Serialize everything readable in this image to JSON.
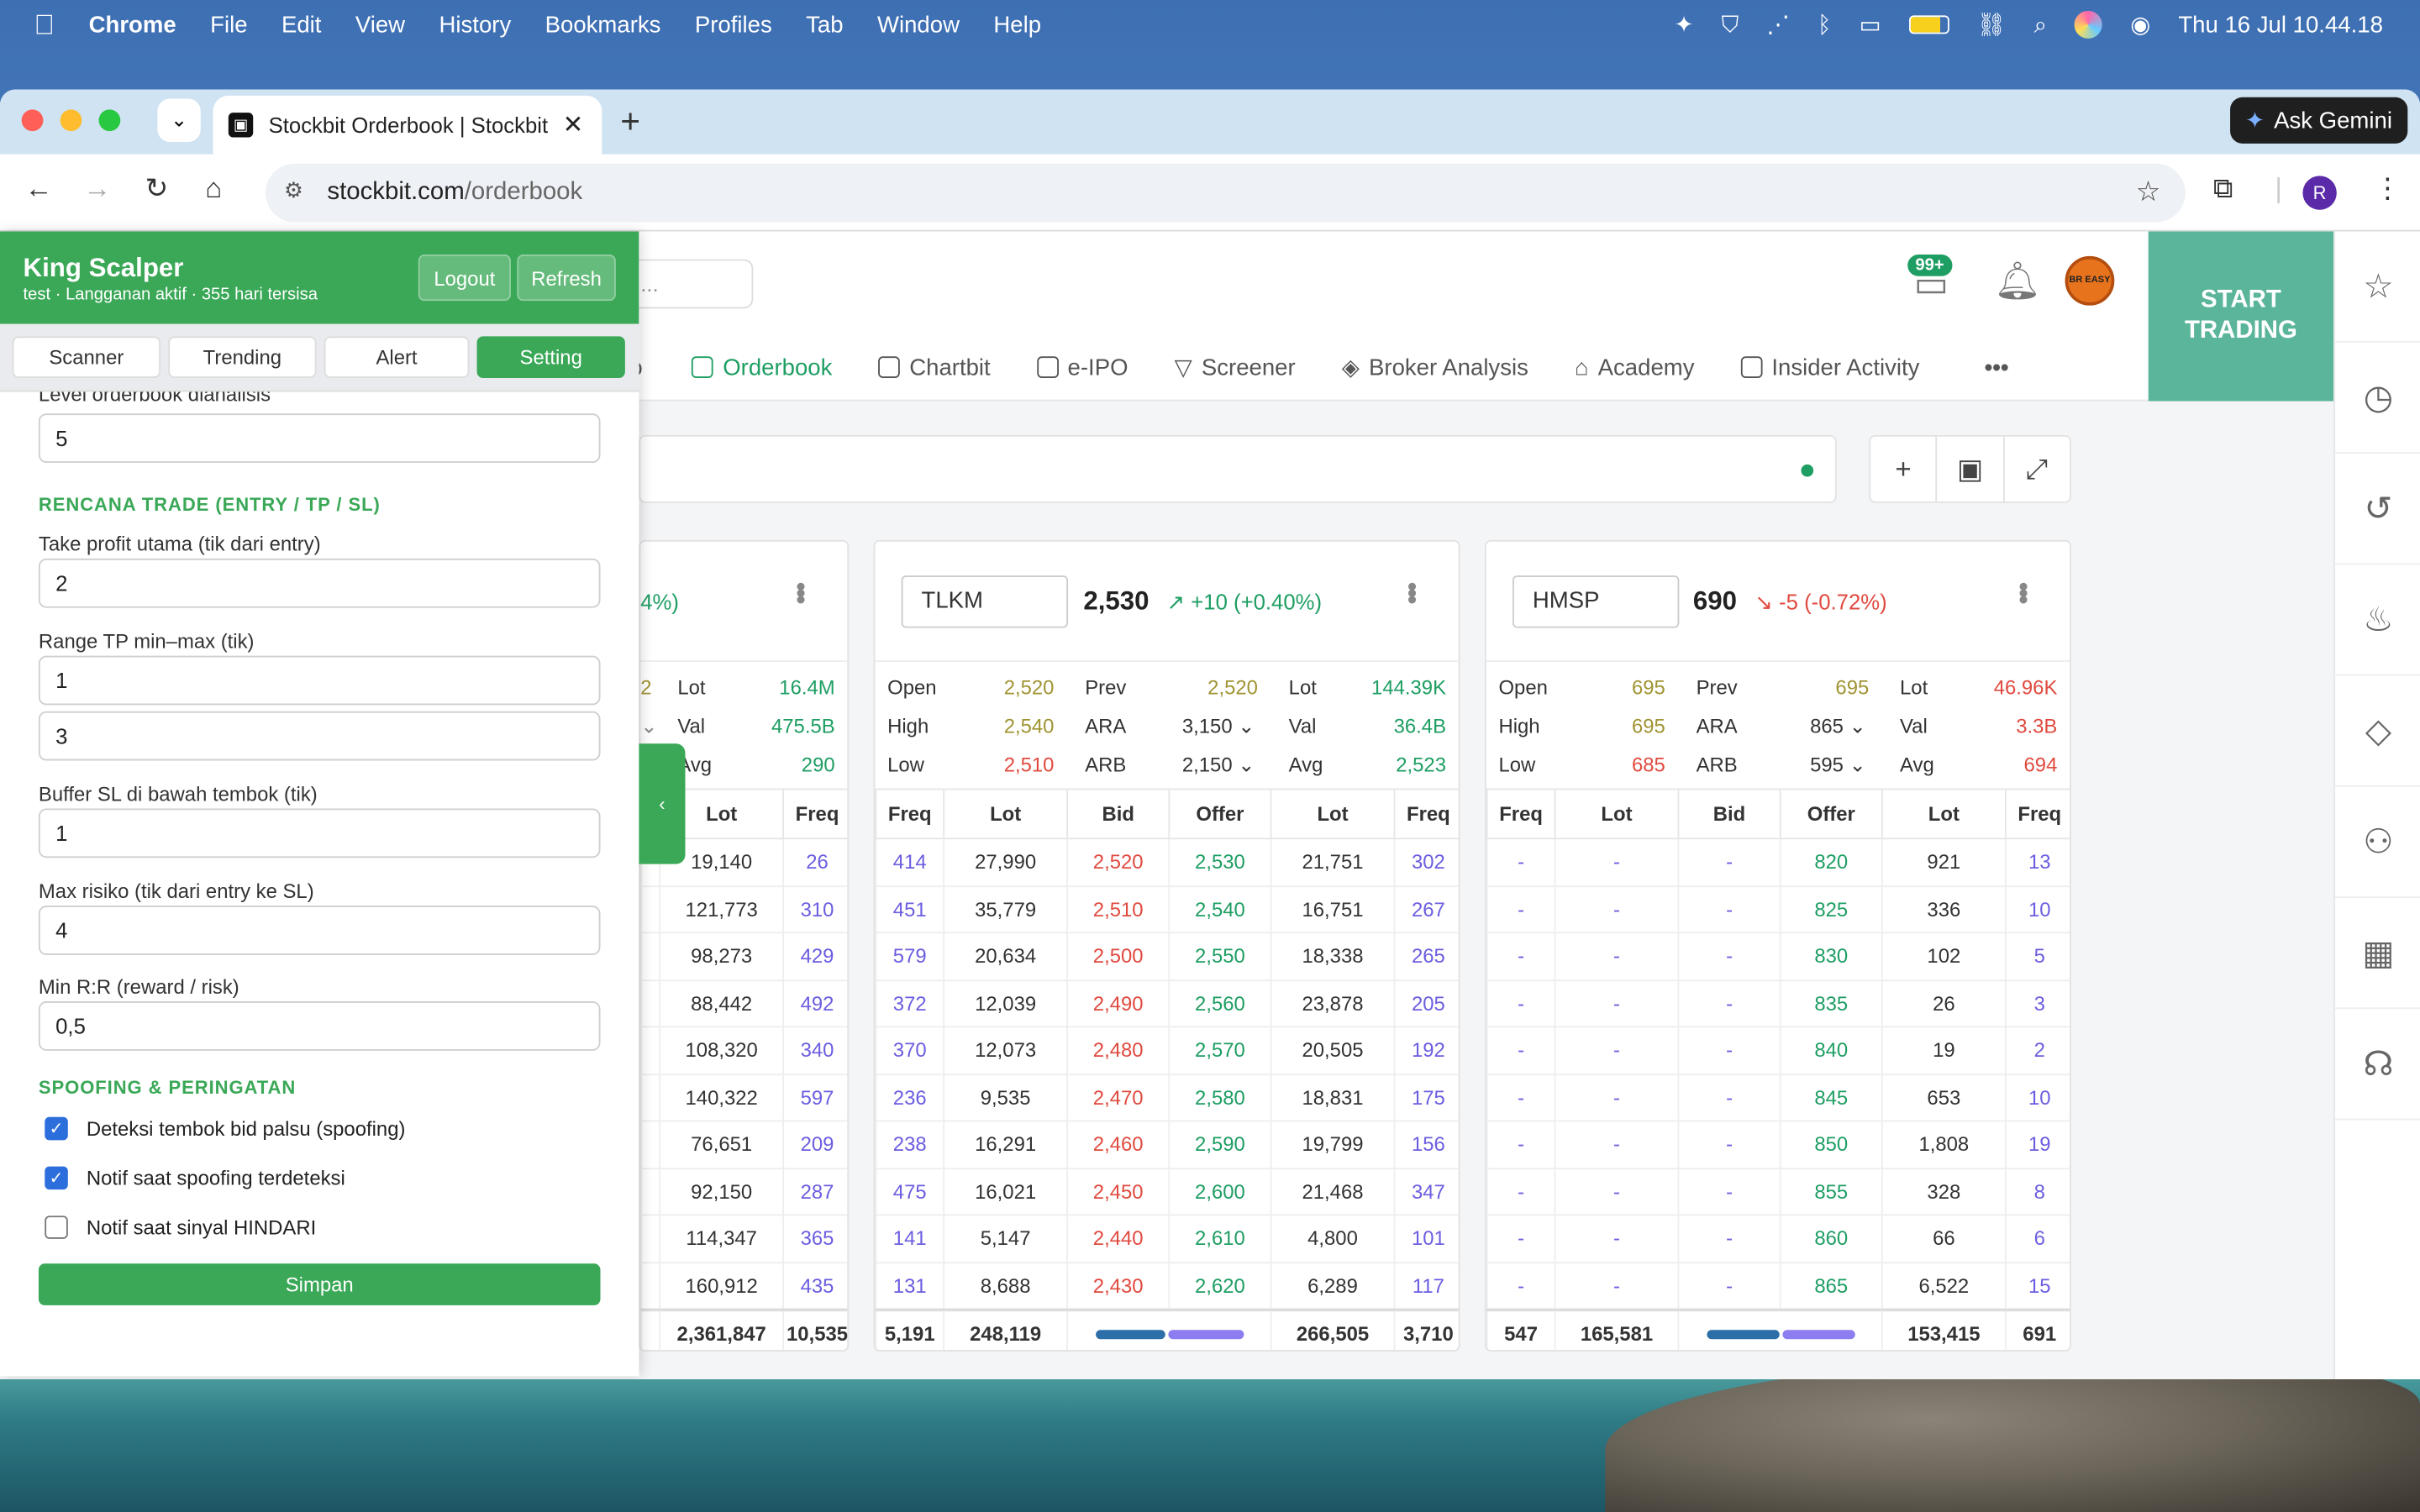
{
  "menubar": {
    "app": "Chrome",
    "items": [
      "File",
      "Edit",
      "View",
      "History",
      "Bookmarks",
      "Profiles",
      "Tab",
      "Window",
      "Help"
    ],
    "clock": "Thu 16 Jul  10.44.18"
  },
  "browser": {
    "tab_title": "Stockbit Orderbook | Stockbit",
    "url_host": "stockbit.com",
    "url_path": "/orderbook",
    "gemini_label": "Ask Gemini",
    "profile_initial": "R"
  },
  "site": {
    "search_placeholder": "...",
    "nav": [
      {
        "label": "o"
      },
      {
        "label": "Orderbook"
      },
      {
        "label": "Chartbit"
      },
      {
        "label": "e-IPO"
      },
      {
        "label": "Screener"
      },
      {
        "label": "Broker Analysis"
      },
      {
        "label": "Academy"
      },
      {
        "label": "Insider Activity"
      }
    ],
    "more": "•••",
    "chat_badge": "99+",
    "start_trading_line1": "START",
    "start_trading_line2": "TRADING",
    "user_avatar_text": "BR EASY"
  },
  "cards": [
    {
      "ticker": "",
      "change": "4%)",
      "stats": {
        "lot_label": "Lot",
        "lot": "16.4M",
        "val_label": "Val",
        "val": "475.5B",
        "avg_label": "Avg",
        "avg": "290",
        "partial1": "2",
        "partial2": "⌄"
      },
      "headers": [
        "Lot",
        "Freq"
      ],
      "rows": [
        [
          "19,140",
          "26"
        ],
        [
          "121,773",
          "310"
        ],
        [
          "98,273",
          "429"
        ],
        [
          "88,442",
          "492"
        ],
        [
          "108,320",
          "340"
        ],
        [
          "140,322",
          "597"
        ],
        [
          "76,651",
          "209"
        ],
        [
          "92,150",
          "287"
        ],
        [
          "114,347",
          "365"
        ],
        [
          "160,912",
          "435"
        ]
      ],
      "totals": [
        "2,361,847",
        "10,535"
      ]
    },
    {
      "ticker": "TLKM",
      "price": "2,530",
      "change": "↗ +10 (+0.40%)",
      "stats": {
        "open_label": "Open",
        "open": "2,520",
        "high_label": "High",
        "high": "2,540",
        "low_label": "Low",
        "low": "2,510",
        "prev_label": "Prev",
        "prev": "2,520",
        "ara_label": "ARA",
        "ara": "3,150",
        "arb_label": "ARB",
        "arb": "2,150",
        "lot_label": "Lot",
        "lot": "144.39K",
        "val_label": "Val",
        "val": "36.4B",
        "avg_label": "Avg",
        "avg": "2,523"
      },
      "headers": [
        "Freq",
        "Lot",
        "Bid",
        "Offer",
        "Lot",
        "Freq"
      ],
      "rows": [
        [
          "414",
          "27,990",
          "2,520",
          "2,530",
          "21,751",
          "302"
        ],
        [
          "451",
          "35,779",
          "2,510",
          "2,540",
          "16,751",
          "267"
        ],
        [
          "579",
          "20,634",
          "2,500",
          "2,550",
          "18,338",
          "265"
        ],
        [
          "372",
          "12,039",
          "2,490",
          "2,560",
          "23,878",
          "205"
        ],
        [
          "370",
          "12,073",
          "2,480",
          "2,570",
          "20,505",
          "192"
        ],
        [
          "236",
          "9,535",
          "2,470",
          "2,580",
          "18,831",
          "175"
        ],
        [
          "238",
          "16,291",
          "2,460",
          "2,590",
          "19,799",
          "156"
        ],
        [
          "475",
          "16,021",
          "2,450",
          "2,600",
          "21,468",
          "347"
        ],
        [
          "141",
          "5,147",
          "2,440",
          "2,610",
          "4,800",
          "101"
        ],
        [
          "131",
          "8,688",
          "2,430",
          "2,620",
          "6,289",
          "117"
        ]
      ],
      "totals": [
        "5,191",
        "248,119",
        "",
        "266,505",
        "3,710"
      ],
      "bid_share": 0.48
    },
    {
      "ticker": "HMSP",
      "price": "690",
      "change": "↘ -5 (-0.72%)",
      "stats": {
        "open_label": "Open",
        "open": "695",
        "high_label": "High",
        "high": "695",
        "low_label": "Low",
        "low": "685",
        "prev_label": "Prev",
        "prev": "695",
        "ara_label": "ARA",
        "ara": "865",
        "arb_label": "ARB",
        "arb": "595",
        "lot_label": "Lot",
        "lot": "46.96K",
        "val_label": "Val",
        "val": "3.3B",
        "avg_label": "Avg",
        "avg": "694"
      },
      "headers": [
        "Freq",
        "Lot",
        "Bid",
        "Offer",
        "Lot",
        "Freq"
      ],
      "rows": [
        [
          "-",
          "-",
          "-",
          "820",
          "921",
          "13"
        ],
        [
          "-",
          "-",
          "-",
          "825",
          "336",
          "10"
        ],
        [
          "-",
          "-",
          "-",
          "830",
          "102",
          "5"
        ],
        [
          "-",
          "-",
          "-",
          "835",
          "26",
          "3"
        ],
        [
          "-",
          "-",
          "-",
          "840",
          "19",
          "2"
        ],
        [
          "-",
          "-",
          "-",
          "845",
          "653",
          "10"
        ],
        [
          "-",
          "-",
          "-",
          "850",
          "1,808",
          "19"
        ],
        [
          "-",
          "-",
          "-",
          "855",
          "328",
          "8"
        ],
        [
          "-",
          "-",
          "-",
          "860",
          "66",
          "6"
        ],
        [
          "-",
          "-",
          "-",
          "865",
          "6,522",
          "15"
        ]
      ],
      "totals": [
        "547",
        "165,581",
        "",
        "153,415",
        "691"
      ],
      "bid_share": 0.5
    }
  ],
  "extension": {
    "title": "King Scalper",
    "subtitle": "test · Langganan aktif · 355 hari tersisa",
    "logout": "Logout",
    "refresh": "Refresh",
    "tabs": [
      "Scanner",
      "Trending",
      "Alert",
      "Setting"
    ],
    "active_tab": "Setting",
    "fields": {
      "level_label": "Level orderbook dianalisis",
      "level_value": "5",
      "section_trade": "RENCANA TRADE (ENTRY / TP / SL)",
      "tp_label": "Take profit utama (tik dari entry)",
      "tp_value": "2",
      "range_label": "Range TP min–max (tik)",
      "range_min": "1",
      "range_max": "3",
      "buffer_label": "Buffer SL di bawah tembok (tik)",
      "buffer_value": "1",
      "risk_label": "Max risiko (tik dari entry ke SL)",
      "risk_value": "4",
      "rr_label": "Min R:R (reward / risk)",
      "rr_value": "0,5",
      "section_spoof": "SPOOFING & PERINGATAN",
      "cb1": "Deteksi tembok bid palsu (spoofing)",
      "cb1_checked": true,
      "cb2": "Notif saat spoofing terdeteksi",
      "cb2_checked": true,
      "cb3": "Notif saat sinyal HINDARI",
      "cb3_checked": false,
      "save": "Simpan"
    },
    "collapse_glyph": "‹"
  },
  "colors": {
    "green": "#1e9e63",
    "ext_green": "#3aa857",
    "red": "#e04a3f",
    "olive": "#a09433",
    "purple": "#6b5ee0",
    "start_trading": "#5ab59b"
  }
}
